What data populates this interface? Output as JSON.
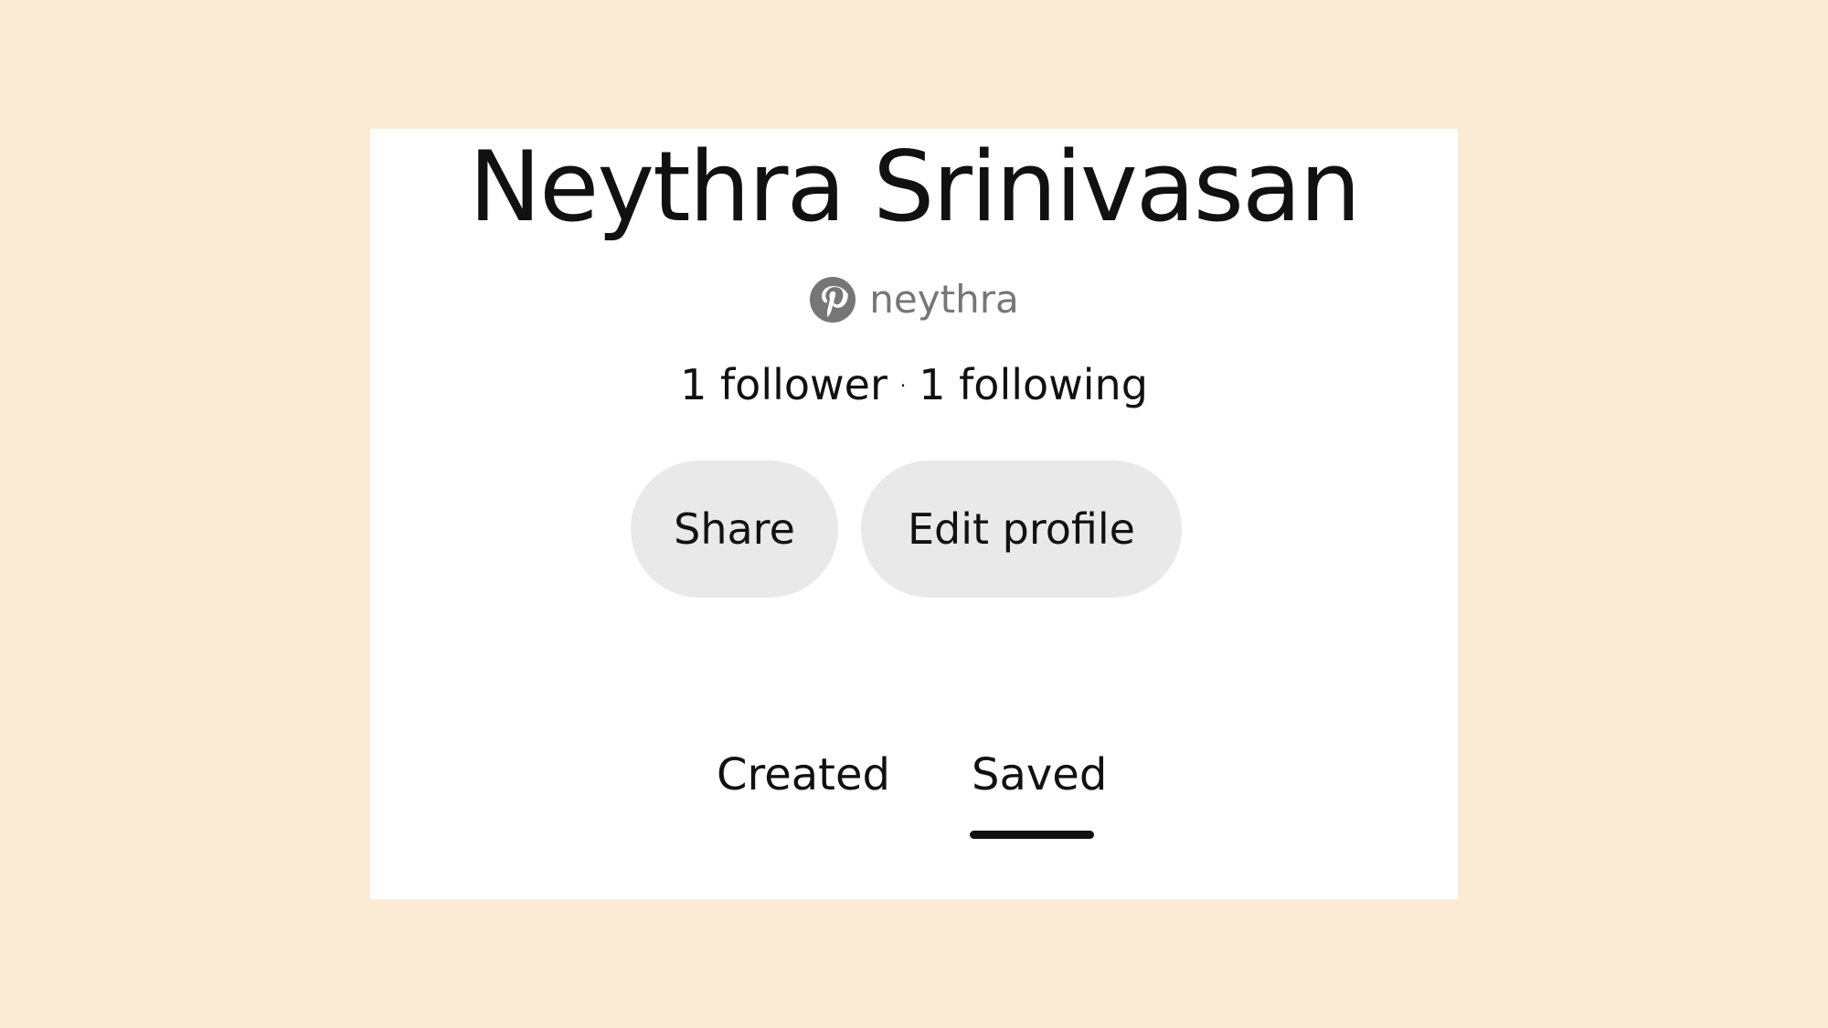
{
  "profile": {
    "name": "Neythra Srinivasan",
    "handle": "neythra",
    "followers": "1 follower",
    "separator": "·",
    "following": "1 following"
  },
  "actions": {
    "share_label": "Share",
    "edit_label": "Edit profile"
  },
  "tabs": [
    {
      "label": "Created",
      "active": false
    },
    {
      "label": "Saved",
      "active": true
    }
  ],
  "icons": {
    "handle_icon": "pinterest-logo-icon"
  },
  "colors": {
    "background": "#fcebd4",
    "card": "#ffffff",
    "button": "#e9e9e9",
    "text": "#111111",
    "muted": "#767676"
  }
}
